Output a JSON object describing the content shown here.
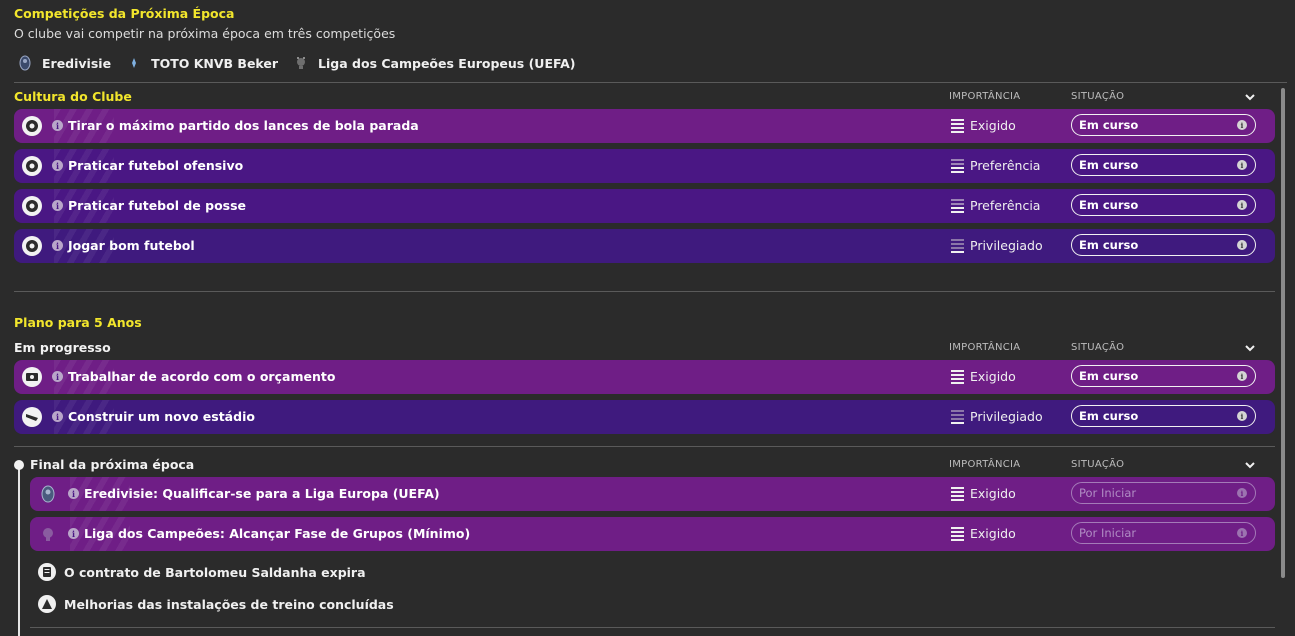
{
  "competitions": {
    "title": "Competições da Próxima Época",
    "subtitle": "O clube vai competir na próxima época em três competições",
    "items": [
      "Eredivisie",
      "TOTO KNVB Beker",
      "Liga dos Campeões Europeus (UEFA)"
    ]
  },
  "culture": {
    "title": "Cultura do Clube",
    "col_importance": "IMPORTÂNCIA",
    "col_status": "SITUAÇÃO",
    "rows": [
      {
        "label": "Tirar o máximo partido dos lances de bola parada",
        "importance": "Exigido",
        "status": "Em curso"
      },
      {
        "label": "Praticar futebol ofensivo",
        "importance": "Preferência",
        "status": "Em curso"
      },
      {
        "label": "Praticar futebol de posse",
        "importance": "Preferência",
        "status": "Em curso"
      },
      {
        "label": "Jogar bom futebol",
        "importance": "Privilegiado",
        "status": "Em curso"
      }
    ]
  },
  "plan": {
    "title": "Plano para 5 Anos",
    "in_progress": {
      "title": "Em progresso",
      "col_importance": "IMPORTÂNCIA",
      "col_status": "SITUAÇÃO",
      "rows": [
        {
          "label": "Trabalhar de acordo com o orçamento",
          "importance": "Exigido",
          "status": "Em curso"
        },
        {
          "label": "Construir um novo estádio",
          "importance": "Privilegiado",
          "status": "Em curso"
        }
      ]
    },
    "next_season": {
      "title": "Final da próxima época",
      "col_importance": "IMPORTÂNCIA",
      "col_status": "SITUAÇÃO",
      "rows": [
        {
          "label": "Eredivisie: Qualificar-se para a Liga Europa (UEFA)",
          "importance": "Exigido",
          "status": "Por Iniciar"
        },
        {
          "label": "Liga dos Campeões: Alcançar Fase de Grupos (Mínimo)",
          "importance": "Exigido",
          "status": "Por Iniciar"
        }
      ],
      "events": [
        "O contrato de Bartolomeu Saldanha expira",
        "Melhorias das instalações de treino concluídas"
      ]
    }
  },
  "colors": {
    "title_yellow": "#f2e62c",
    "row_magenta": "#6f1e86",
    "row_violet": "#4a1784",
    "background": "#2b2b2b"
  }
}
